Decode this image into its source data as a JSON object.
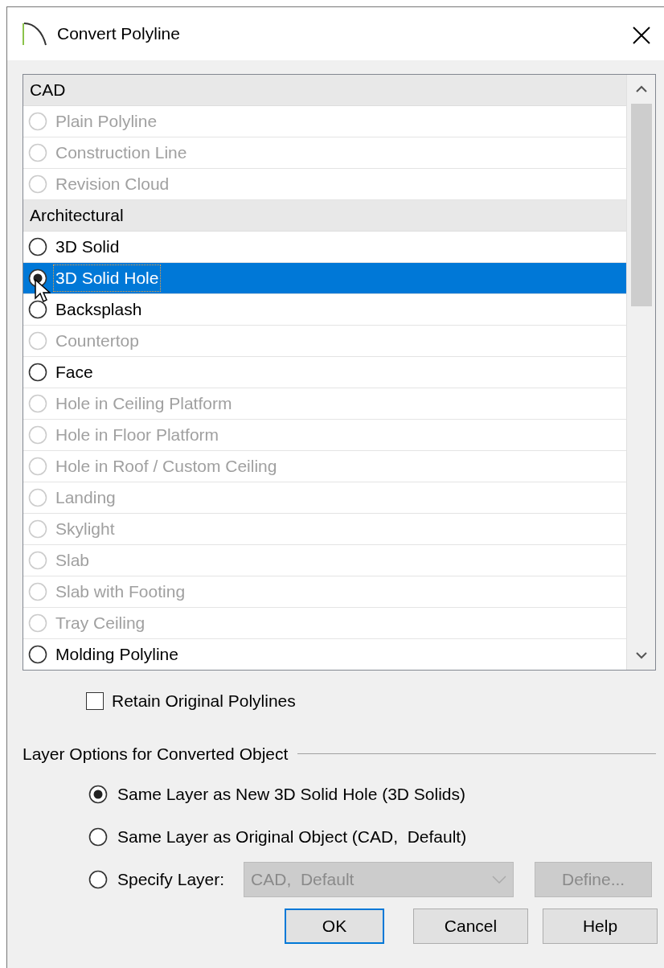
{
  "window": {
    "title": "Convert Polyline"
  },
  "list": {
    "groups": [
      {
        "label": "CAD",
        "items": [
          {
            "label": "Plain Polyline",
            "disabled": true,
            "selected": false
          },
          {
            "label": "Construction Line",
            "disabled": true,
            "selected": false
          },
          {
            "label": "Revision Cloud",
            "disabled": true,
            "selected": false
          }
        ]
      },
      {
        "label": "Architectural",
        "items": [
          {
            "label": "3D Solid",
            "disabled": false,
            "selected": false
          },
          {
            "label": "3D Solid Hole",
            "disabled": false,
            "selected": true
          },
          {
            "label": "Backsplash",
            "disabled": false,
            "selected": false
          },
          {
            "label": "Countertop",
            "disabled": true,
            "selected": false
          },
          {
            "label": "Face",
            "disabled": false,
            "selected": false
          },
          {
            "label": "Hole in Ceiling Platform",
            "disabled": true,
            "selected": false
          },
          {
            "label": "Hole in Floor Platform",
            "disabled": true,
            "selected": false
          },
          {
            "label": "Hole in Roof / Custom Ceiling",
            "disabled": true,
            "selected": false
          },
          {
            "label": "Landing",
            "disabled": true,
            "selected": false
          },
          {
            "label": "Skylight",
            "disabled": true,
            "selected": false
          },
          {
            "label": "Slab",
            "disabled": true,
            "selected": false
          },
          {
            "label": "Slab with Footing",
            "disabled": true,
            "selected": false
          },
          {
            "label": "Tray Ceiling",
            "disabled": true,
            "selected": false
          },
          {
            "label": "Molding Polyline",
            "disabled": false,
            "selected": false
          }
        ]
      }
    ]
  },
  "retain": {
    "label": "Retain Original Polylines",
    "checked": false
  },
  "layer_options": {
    "title": "Layer Options for Converted Object",
    "options": [
      {
        "label": "Same Layer as New 3D Solid Hole (3D Solids)",
        "selected": true
      },
      {
        "label": "Same Layer as Original Object (CAD,  Default)",
        "selected": false
      },
      {
        "label": "Specify Layer:",
        "selected": false
      }
    ],
    "layer_select": {
      "value": "CAD,  Default",
      "disabled": true
    },
    "define_button": {
      "label": "Define...",
      "disabled": true
    }
  },
  "buttons": [
    {
      "label": "OK",
      "default": true
    },
    {
      "label": "Cancel",
      "default": false
    },
    {
      "label": "Help",
      "default": false
    }
  ]
}
